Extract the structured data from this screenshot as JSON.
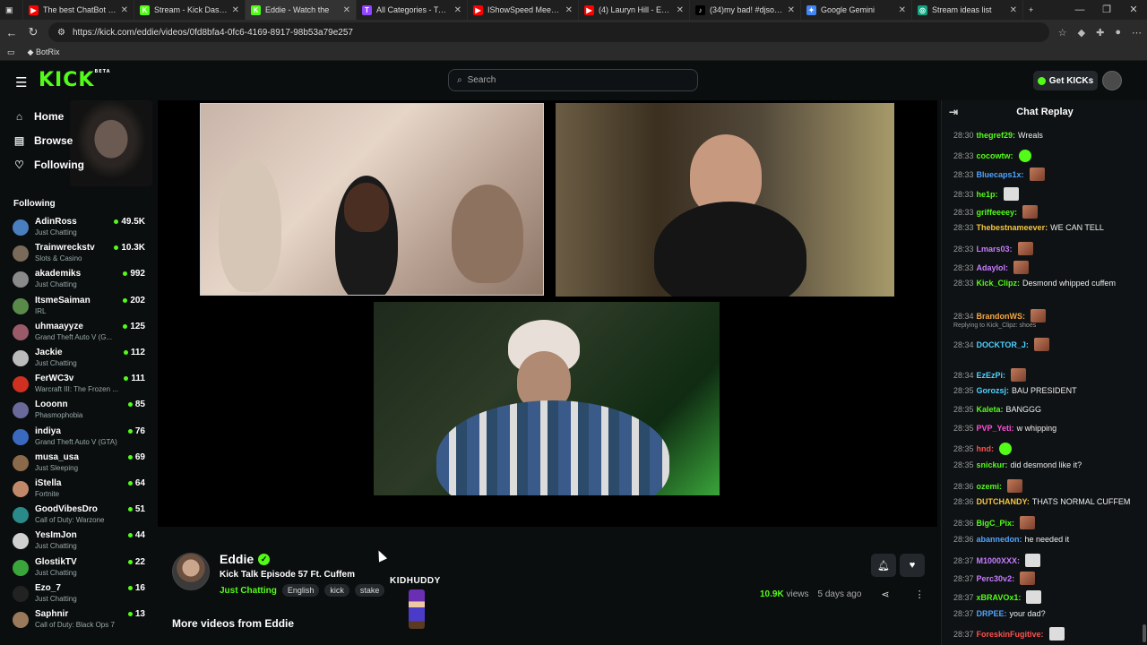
{
  "browser": {
    "tabs": [
      {
        "title": "The best ChatBot and V",
        "color": "#ff0000",
        "glyph": "▶"
      },
      {
        "title": "Stream - Kick Dashboa",
        "color": "#53fc18",
        "glyph": "K"
      },
      {
        "title": "Eddie - Watch the",
        "color": "#53fc18",
        "glyph": "K",
        "active": true
      },
      {
        "title": "All Categories - Twitch",
        "color": "#9146ff",
        "glyph": "T"
      },
      {
        "title": "IShowSpeed Meets cu",
        "color": "#ff0000",
        "glyph": "▶"
      },
      {
        "title": "(4) Lauryn Hill - Ex Fact",
        "color": "#ff0000",
        "glyph": "▶"
      },
      {
        "title": "(34)my bad! #djsonic",
        "color": "#000000",
        "glyph": "♪"
      },
      {
        "title": "Google Gemini",
        "color": "#4285f4",
        "glyph": "✦"
      },
      {
        "title": "Stream ideas list",
        "color": "#10a37f",
        "glyph": "◎"
      }
    ],
    "url": "https://kick.com/eddie/videos/0fd8bfa4-0fc6-4169-8917-98b53a79e257",
    "bookmark": "BotRix"
  },
  "header": {
    "logo": "KICK",
    "logo_badge": "BETA",
    "search_placeholder": "Search",
    "get_kicks": "Get KICKs"
  },
  "sidebar": {
    "nav": [
      "Home",
      "Browse",
      "Following"
    ],
    "following_title": "Following",
    "following": [
      {
        "name": "AdinRoss",
        "game": "Just Chatting",
        "viewers": "49.5K",
        "color": "#4a7fbf"
      },
      {
        "name": "Trainwreckstv",
        "game": "Slots & Casino",
        "viewers": "10.3K",
        "color": "#7a6a5a"
      },
      {
        "name": "akademiks",
        "game": "Just Chatting",
        "viewers": "992",
        "color": "#8a8a8a"
      },
      {
        "name": "ItsmeSaiman",
        "game": "IRL",
        "viewers": "202",
        "color": "#5a8a4a"
      },
      {
        "name": "uhmaayyze",
        "game": "Grand Theft Auto V (G...",
        "viewers": "125",
        "color": "#9a5a6a"
      },
      {
        "name": "Jackie",
        "game": "Just Chatting",
        "viewers": "112",
        "color": "#bbbbbb"
      },
      {
        "name": "FerWC3v",
        "game": "Warcraft III: The Frozen ...",
        "viewers": "111",
        "color": "#d03020"
      },
      {
        "name": "Looonn",
        "game": "Phasmophobia",
        "viewers": "85",
        "color": "#6a6a9a"
      },
      {
        "name": "indiya",
        "game": "Grand Theft Auto V (GTA)",
        "viewers": "76",
        "color": "#3a6abf"
      },
      {
        "name": "musa_usa",
        "game": "Just Sleeping",
        "viewers": "69",
        "color": "#8a6a4a"
      },
      {
        "name": "iStella",
        "game": "Fortnite",
        "viewers": "64",
        "color": "#c08a6a"
      },
      {
        "name": "GoodVibesDro",
        "game": "Call of Duty: Warzone",
        "viewers": "51",
        "color": "#2a8a8a"
      },
      {
        "name": "YesImJon",
        "game": "Just Chatting",
        "viewers": "44",
        "color": "#d0d0d0"
      },
      {
        "name": "GlostikTV",
        "game": "Just Chatting",
        "viewers": "22",
        "color": "#3aa53a"
      },
      {
        "name": "Ezo_7",
        "game": "Just Chatting",
        "viewers": "16",
        "color": "#222222"
      },
      {
        "name": "Saphnir",
        "game": "Call of Duty: Black Ops 7",
        "viewers": "13",
        "color": "#9a7a5a"
      }
    ]
  },
  "video": {
    "channel": "Eddie",
    "title": "Kick Talk Episode 57 Ft. Cuffem",
    "category": "Just Chatting",
    "tags": [
      "English",
      "kick",
      "stake"
    ],
    "emote_label": "KIDHUDDY",
    "views": "10.9K",
    "views_label": "views",
    "posted": "5 days ago",
    "more_videos": "More videos from Eddie"
  },
  "chat": {
    "title": "Chat Replay",
    "replying": "Replying to Kick_Clipz: shoes",
    "messages": [
      {
        "time": "28:30",
        "user": "thegref29:",
        "text": "Wreals",
        "color": "#53fc18"
      },
      {
        "time": "28:33",
        "user": "cocowtw:",
        "text": "",
        "color": "#53fc18",
        "emote": "g"
      },
      {
        "time": "28:33",
        "user": "Bluecaps1x:",
        "text": "",
        "color": "#4fa3ff",
        "emote": "b"
      },
      {
        "time": "28:33",
        "user": "he1p:",
        "text": "",
        "color": "#53fc18",
        "emote": "w"
      },
      {
        "time": "28:33",
        "user": "griffeeeey:",
        "text": "",
        "color": "#53fc18",
        "emote": "b"
      },
      {
        "time": "28:33",
        "user": "Thebestnameever:",
        "text": "WE CAN TELL",
        "color": "#f5c542"
      },
      {
        "time": "28:33",
        "user": "Lmars03:",
        "text": "",
        "color": "#c77dff",
        "emote": "b"
      },
      {
        "time": "28:33",
        "user": "Adaylol:",
        "text": "",
        "color": "#c77dff",
        "emote": "b"
      },
      {
        "time": "28:33",
        "user": "Kick_Clipz:",
        "text": "Desmond whipped cuffem",
        "color": "#53fc18"
      },
      {
        "time": "28:34",
        "user": "BrandonWS:",
        "text": "",
        "color": "#f5a742",
        "emote": "b"
      },
      {
        "time": "28:34",
        "user": "DOCKTOR_J:",
        "text": "",
        "color": "#4fd1ff",
        "emote": "b"
      },
      {
        "time": "28:34",
        "user": "EzEzPi:",
        "text": "",
        "color": "#4fd1ff",
        "emote": "b"
      },
      {
        "time": "28:35",
        "user": "Gorozsj:",
        "text": "BAU PRESIDENT",
        "color": "#4fd1ff"
      },
      {
        "time": "28:35",
        "user": "Kaleta:",
        "text": "BANGGG",
        "color": "#53fc18"
      },
      {
        "time": "28:35",
        "user": "PVP_Yeti:",
        "text": "w whipping",
        "color": "#ff4fd8"
      },
      {
        "time": "28:35",
        "user": "hnd:",
        "text": "",
        "color": "#ff4f4f",
        "emote": "g"
      },
      {
        "time": "28:35",
        "user": "snickur:",
        "text": "did desmond like it?",
        "color": "#53fc18"
      },
      {
        "time": "28:36",
        "user": "ozemi:",
        "text": "",
        "color": "#53fc18",
        "emote": "b"
      },
      {
        "time": "28:36",
        "user": "DUTCHANDY:",
        "text": "THATS NORMAL CUFFEM",
        "color": "#f5c542"
      },
      {
        "time": "28:36",
        "user": "BigC_Pix:",
        "text": "",
        "color": "#53fc18",
        "emote": "b"
      },
      {
        "time": "28:36",
        "user": "abannedon:",
        "text": "he needed it",
        "color": "#4fa3ff"
      },
      {
        "time": "28:37",
        "user": "M1000XXX:",
        "text": "",
        "color": "#c77dff",
        "emote": "w"
      },
      {
        "time": "28:37",
        "user": "Perc30v2:",
        "text": "",
        "color": "#c77dff",
        "emote": "b"
      },
      {
        "time": "28:37",
        "user": "xBRAVOx1:",
        "text": "",
        "color": "#53fc18",
        "emote": "w"
      },
      {
        "time": "28:37",
        "user": "DRPEE:",
        "text": "your dad?",
        "color": "#4fa3ff"
      },
      {
        "time": "28:37",
        "user": "ForeskinFugitive:",
        "text": "",
        "color": "#ff4f4f",
        "emote": "w"
      }
    ]
  }
}
